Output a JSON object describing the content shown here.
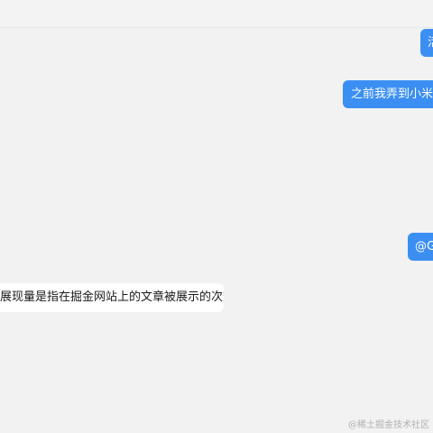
{
  "chat": {
    "messages": [
      {
        "direction": "outgoing",
        "text": "活"
      },
      {
        "direction": "outgoing",
        "text": "之前我弄到小米智"
      },
      {
        "direction": "outgoing",
        "text": "@G"
      },
      {
        "direction": "incoming",
        "text": "展现量是指在掘金网站上的文章被展示的次数。"
      }
    ]
  },
  "watermark": "@稀土掘金技术社区",
  "colors": {
    "background": "#f2f2f2",
    "outgoing_bubble": "#3b8ff2",
    "incoming_bubble": "#ffffff"
  }
}
